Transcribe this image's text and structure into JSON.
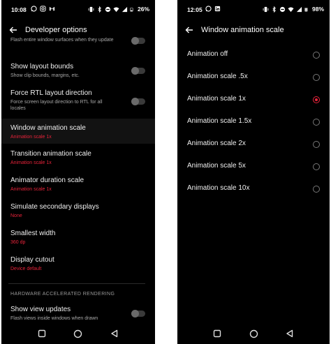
{
  "left_screen": {
    "status": {
      "time": "10:08",
      "battery": "26%"
    },
    "title": "Developer options",
    "partial_item_subtitle": "Flash entire window surfaces when they update",
    "items": [
      {
        "title": "Show layout bounds",
        "subtitle": "Show clip bounds, margins, etc."
      },
      {
        "title": "Force RTL layout direction",
        "subtitle": "Force screen layout direction to RTL for all locales"
      },
      {
        "title": "Window animation scale",
        "subtitle": "Animation scale 1x"
      },
      {
        "title": "Transition animation scale",
        "subtitle": "Animation scale 1x"
      },
      {
        "title": "Animator duration scale",
        "subtitle": "Animation scale 1x"
      },
      {
        "title": "Simulate secondary displays",
        "subtitle": "None"
      },
      {
        "title": "Smallest width",
        "subtitle": "360 dp"
      },
      {
        "title": "Display cutout",
        "subtitle": "Device default"
      },
      {
        "title": "Show view updates",
        "subtitle": "Flash views inside windows when drawn"
      }
    ],
    "section_header": "HARDWARE ACCELERATED RENDERING"
  },
  "right_screen": {
    "status": {
      "time": "12:05",
      "battery": "98%"
    },
    "title": "Window animation scale",
    "options": [
      {
        "label": "Animation off",
        "selected": false
      },
      {
        "label": "Animation scale .5x",
        "selected": false
      },
      {
        "label": "Animation scale 1x",
        "selected": true
      },
      {
        "label": "Animation scale 1.5x",
        "selected": false
      },
      {
        "label": "Animation scale 2x",
        "selected": false
      },
      {
        "label": "Animation scale 5x",
        "selected": false
      },
      {
        "label": "Animation scale 10x",
        "selected": false
      }
    ]
  },
  "colors": {
    "accent": "#e8233a",
    "background": "#000000",
    "text": "#f0f0f0",
    "subtext": "#a9a9a9"
  },
  "icons": {
    "status_left": [
      "whatsapp-icon",
      "instagram-icon",
      "gmail-icon"
    ],
    "status_left_right_screen": [
      "whatsapp-icon",
      "linkedin-icon"
    ],
    "status_right": [
      "vibrate-icon",
      "bluetooth-icon",
      "do-not-disturb-icon",
      "wifi-icon",
      "signal-icon",
      "battery-icon"
    ],
    "navigation": [
      "back-arrow-icon",
      "recents-square-icon",
      "home-circle-icon",
      "back-triangle-icon"
    ]
  }
}
